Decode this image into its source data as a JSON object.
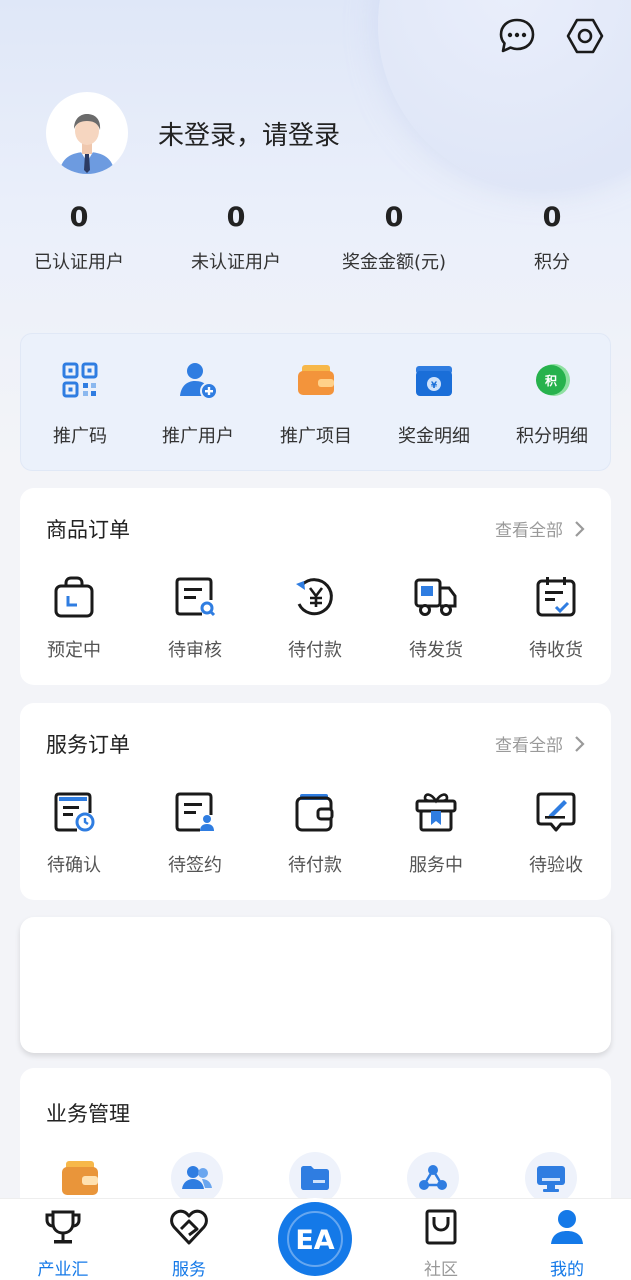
{
  "header": {
    "login_prompt": "未登录，请登录",
    "icons": [
      "message-icon",
      "settings-icon"
    ]
  },
  "stats": [
    {
      "value": "0",
      "label": "已认证用户"
    },
    {
      "value": "0",
      "label": "未认证用户"
    },
    {
      "value": "0",
      "label": "奖金金额(元)"
    },
    {
      "value": "0",
      "label": "积分"
    }
  ],
  "quick_actions": [
    {
      "label": "推广码",
      "icon": "qr-code-icon"
    },
    {
      "label": "推广用户",
      "icon": "add-user-icon"
    },
    {
      "label": "推广项目",
      "icon": "wallet-icon"
    },
    {
      "label": "奖金明细",
      "icon": "cash-wallet-icon"
    },
    {
      "label": "积分明细",
      "icon": "points-icon",
      "icon_text": "积"
    }
  ],
  "goods_orders": {
    "title": "商品订单",
    "view_all": "查看全部",
    "items": [
      {
        "label": "预定中",
        "icon": "bag-icon"
      },
      {
        "label": "待审核",
        "icon": "review-icon"
      },
      {
        "label": "待付款",
        "icon": "payment-icon"
      },
      {
        "label": "待发货",
        "icon": "truck-icon"
      },
      {
        "label": "待收货",
        "icon": "receive-icon"
      }
    ]
  },
  "service_orders": {
    "title": "服务订单",
    "view_all": "查看全部",
    "items": [
      {
        "label": "待确认",
        "icon": "pending-confirm-icon"
      },
      {
        "label": "待签约",
        "icon": "sign-icon"
      },
      {
        "label": "待付款",
        "icon": "wallet-pay-icon"
      },
      {
        "label": "服务中",
        "icon": "gift-icon"
      },
      {
        "label": "待验收",
        "icon": "inspect-icon"
      }
    ]
  },
  "business": {
    "title": "业务管理"
  },
  "tabbar": {
    "items": [
      {
        "label": "产业汇",
        "icon": "trophy-icon"
      },
      {
        "label": "服务",
        "icon": "heart-icon"
      },
      {
        "label": "社区",
        "icon": "community-icon"
      },
      {
        "label": "我的",
        "icon": "user-icon"
      }
    ],
    "center_logo": "EA"
  },
  "colors": {
    "accent": "#1479e8",
    "tab_inactive": "#999999",
    "icon_dark": "#1a1a1a"
  }
}
